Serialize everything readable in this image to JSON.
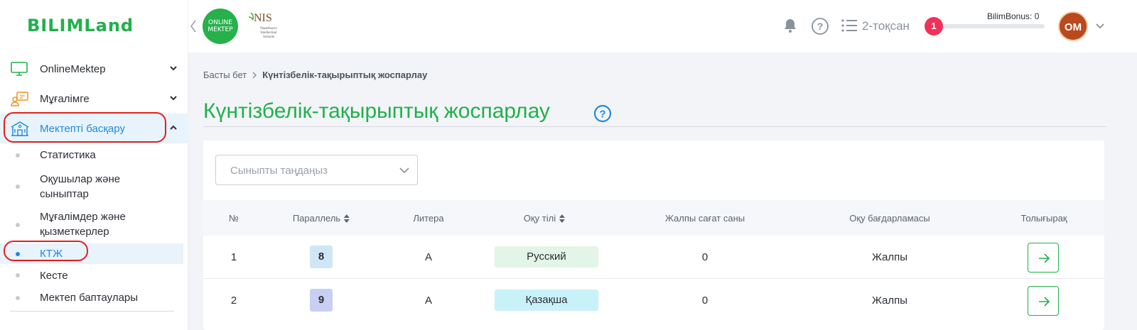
{
  "brand": {
    "name": "BILIMLand",
    "online_logo": "ONLINE MEKTEP",
    "nis": "NIS",
    "nis_sub": "Nazarbayev Intellectual Schools"
  },
  "sidebar": {
    "items": [
      {
        "label": "OnlineMektep",
        "icon": "monitor-icon"
      },
      {
        "label": "Мұғалімге",
        "icon": "teacher-icon"
      },
      {
        "label": "Мектепті басқару",
        "icon": "school-icon"
      }
    ],
    "subitems": [
      "Статистика",
      "Оқушылар және сыныптар",
      "Мұғалімдер және қызметкерлер",
      "КТЖ",
      "Кесте",
      "Мектеп баптаулары"
    ]
  },
  "header": {
    "quarter": "2-тоқсан",
    "notification_count": "1",
    "bonus_label": "BilimBonus: 0",
    "bonus_progress": 0,
    "avatar_initials": "OM"
  },
  "breadcrumb": {
    "home": "Басты бет",
    "current": "Күнтізбелік-тақырыптық жоспарлау"
  },
  "page": {
    "title": "Күнтізбелік-тақырыптық жоспарлау"
  },
  "filter": {
    "class_placeholder": "Сыныпты таңдаңыз"
  },
  "table": {
    "headers": [
      "№",
      "Параллель",
      "Литера",
      "Оқу тілі",
      "Жалпы сағат саны",
      "Оқу бағдарламасы",
      "Толығырақ"
    ],
    "rows": [
      {
        "num": "1",
        "grade": "8",
        "letter": "А",
        "lang": "Русский",
        "hours": "0",
        "program": "Жалпы"
      },
      {
        "num": "2",
        "grade": "9",
        "letter": "А",
        "lang": "Қазақша",
        "hours": "0",
        "program": "Жалпы"
      }
    ]
  },
  "colors": {
    "brand_green": "#21b04b",
    "active_blue": "#1f8ae0",
    "highlight_red": "#e0211d",
    "grade_8_bg": "#cfe7f5",
    "grade_9_bg": "#c9cff3",
    "lang_ru_bg": "#e3f5e6",
    "lang_kz_bg": "#c9f1f8"
  }
}
